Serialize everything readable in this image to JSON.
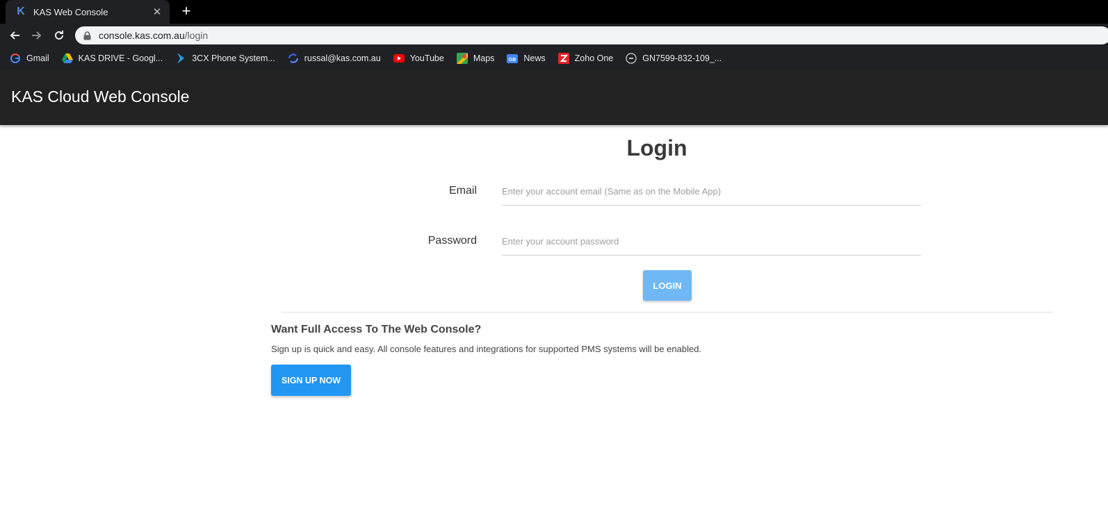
{
  "browser": {
    "tab": {
      "title": "KAS Web Console",
      "favicon_letter": "K"
    },
    "url": {
      "host": "console.kas.com.au",
      "path": "/login"
    },
    "bookmarks": [
      {
        "label": "Gmail",
        "icon": "google-icon"
      },
      {
        "label": "KAS DRIVE - Googl...",
        "icon": "google-drive-icon"
      },
      {
        "label": "3CX Phone System...",
        "icon": "3cx-icon"
      },
      {
        "label": "russal@kas.com.au",
        "icon": "sync-icon"
      },
      {
        "label": "YouTube",
        "icon": "youtube-icon"
      },
      {
        "label": "Maps",
        "icon": "maps-icon"
      },
      {
        "label": "News",
        "icon": "news-icon"
      },
      {
        "label": "Zoho One",
        "icon": "zoho-icon"
      },
      {
        "label": "GN7599-832-109_...",
        "icon": "link-icon"
      }
    ]
  },
  "header": {
    "title": "KAS Cloud Web Console"
  },
  "login": {
    "heading": "Login",
    "email_label": "Email",
    "email_placeholder": "Enter your account email (Same as on the Mobile App)",
    "password_label": "Password",
    "password_placeholder": "Enter your account password",
    "button_label": "LOGIN"
  },
  "signup": {
    "heading": "Want Full Access To The Web Console?",
    "text": "Sign up is quick and easy. All console features and integrations for supported PMS systems will be enabled.",
    "button_label": "SIGN UP NOW"
  },
  "colors": {
    "header_bg": "#222222",
    "login_button": "#6fb8f5",
    "signup_button": "#2196f3"
  }
}
